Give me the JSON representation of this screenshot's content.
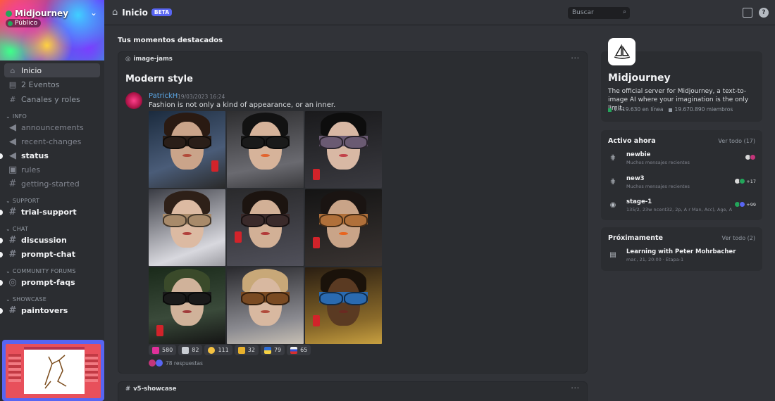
{
  "server": {
    "name": "Midjourney",
    "public_label": "Público"
  },
  "nav": {
    "items": [
      {
        "label": "Inicio",
        "icon": "home-icon"
      },
      {
        "label": "2 Eventos",
        "icon": "calendar-icon"
      },
      {
        "label": "Canales y roles",
        "icon": "channels-roles-icon"
      }
    ]
  },
  "categories": [
    {
      "label": "INFO",
      "channels": [
        {
          "label": "announcements",
          "icon": "megaphone-icon",
          "unread": false
        },
        {
          "label": "recent-changes",
          "icon": "megaphone-icon",
          "unread": false
        },
        {
          "label": "status",
          "icon": "megaphone-icon",
          "unread": true
        },
        {
          "label": "rules",
          "icon": "rules-icon",
          "unread": false
        },
        {
          "label": "getting-started",
          "icon": "hash-icon",
          "unread": false
        }
      ]
    },
    {
      "label": "SUPPORT",
      "channels": [
        {
          "label": "trial-support",
          "icon": "hash-icon",
          "unread": true
        }
      ]
    },
    {
      "label": "CHAT",
      "channels": [
        {
          "label": "discussion",
          "icon": "hash-icon",
          "unread": true
        },
        {
          "label": "prompt-chat",
          "icon": "hash-icon",
          "unread": true
        }
      ]
    },
    {
      "label": "COMMUNITY FORUMS",
      "channels": [
        {
          "label": "prompt-faqs",
          "icon": "forum-icon",
          "unread": true
        }
      ]
    },
    {
      "label": "SHOWCASE",
      "channels": [
        {
          "label": "paintovers",
          "icon": "hash-icon",
          "unread": true
        }
      ]
    }
  ],
  "topbar": {
    "title": "Inicio",
    "beta": "BETA",
    "search_placeholder": "Buscar"
  },
  "main": {
    "section_title": "Tus momentos destacados",
    "post": {
      "channel": "image-jams",
      "title": "Modern style",
      "author": "PatrickH",
      "timestamp": "19/03/2023 16:24",
      "message": "Fashion is not only a kind of appearance, or an inner.",
      "reactions": [
        {
          "emoji": "pink-square-emoji",
          "count": "580",
          "color": "#e0309a"
        },
        {
          "emoji": "envelope-emoji",
          "count": "82",
          "color": "#c9cdd3"
        },
        {
          "emoji": "heart-eyes-emoji",
          "count": "111",
          "color": "#f5c242"
        },
        {
          "emoji": "trophy-emoji",
          "count": "32",
          "color": "#e8b12c"
        },
        {
          "emoji": "ukraine-flag-emoji",
          "count": "79",
          "color": "#2f6fd6"
        },
        {
          "emoji": "russia-flag-emoji",
          "count": "65",
          "color": "#e8e8e8"
        }
      ],
      "replies": "78 respuestas"
    },
    "second_card_channel": "v5-showcase"
  },
  "about": {
    "title": "Midjourney",
    "description": "The official server for Midjourney, a text-to-image AI where your imagination is the only limit.",
    "online": "1.419.630 en línea",
    "members": "19.670.890 miembros"
  },
  "active_now": {
    "title": "Activo ahora",
    "link": "Ver todo (17)",
    "items": [
      {
        "name": "newbie",
        "sub": "Muchos mensajes recientes",
        "count": ""
      },
      {
        "name": "new3",
        "sub": "Muchos mensajes recientes",
        "count": "+17"
      },
      {
        "name": "stage-1",
        "sub": "135/2, 23w ncent32, 2p, A r Man, Acc), Age, A...",
        "count": "+99"
      }
    ]
  },
  "upcoming": {
    "title": "Próximamente",
    "link": "Ver todo (2)",
    "event_name": "Learning with Peter Mohrbacher",
    "event_time": "mar., 21, 20:00 · Etapa-1"
  },
  "colors": {
    "accent": "#5865f2",
    "online": "#23a55a",
    "link": "#5ba7e6"
  }
}
